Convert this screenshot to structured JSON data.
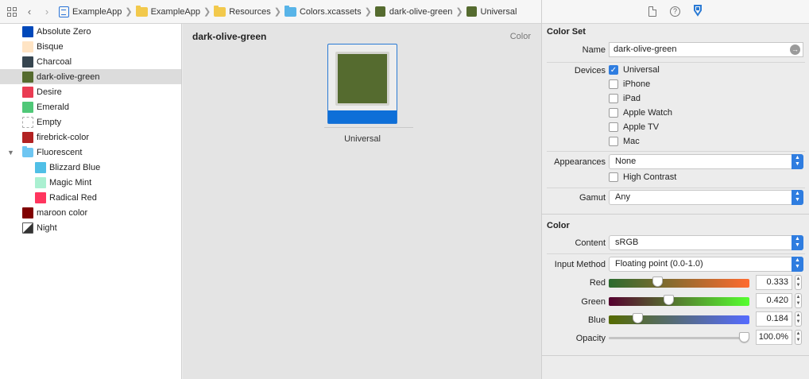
{
  "breadcrumb": {
    "items": [
      {
        "label": "ExampleApp",
        "icon": "project-icon"
      },
      {
        "label": "ExampleApp",
        "icon": "folder-icon"
      },
      {
        "label": "Resources",
        "icon": "folder-icon"
      },
      {
        "label": "Colors.xcassets",
        "icon": "asset-catalog-icon"
      },
      {
        "label": "dark-olive-green",
        "icon": "color-swatch-icon"
      },
      {
        "label": "Universal",
        "icon": "color-swatch-icon"
      }
    ]
  },
  "navigator": {
    "items": [
      {
        "label": "Absolute Zero",
        "color": "#0048ba"
      },
      {
        "label": "Bisque",
        "color": "#ffe4c4"
      },
      {
        "label": "Charcoal",
        "color": "#36454f"
      },
      {
        "label": "dark-olive-green",
        "color": "#556b2f"
      },
      {
        "label": "Desire",
        "color": "#ea3c53"
      },
      {
        "label": "Emerald",
        "color": "#50c878"
      },
      {
        "label": "Empty",
        "color": ""
      },
      {
        "label": "firebrick-color",
        "color": "#b22222"
      },
      {
        "label": "Fluorescent",
        "color": "folder"
      },
      {
        "label": "Blizzard Blue",
        "color": "#50bfe6"
      },
      {
        "label": "Magic Mint",
        "color": "#aaf0d1"
      },
      {
        "label": "Radical Red",
        "color": "#ff355e"
      },
      {
        "label": "maroon color",
        "color": "#800000"
      },
      {
        "label": "Night",
        "color": "night"
      }
    ]
  },
  "editor": {
    "title": "dark-olive-green",
    "type_label": "Color",
    "swatch_color": "#556b2f",
    "well_label": "Universal"
  },
  "inspector": {
    "color_set": {
      "title": "Color Set",
      "name_label": "Name",
      "name_value": "dark-olive-green",
      "devices_label": "Devices",
      "devices": [
        {
          "label": "Universal",
          "checked": true
        },
        {
          "label": "iPhone",
          "checked": false
        },
        {
          "label": "iPad",
          "checked": false
        },
        {
          "label": "Apple Watch",
          "checked": false
        },
        {
          "label": "Apple TV",
          "checked": false
        },
        {
          "label": "Mac",
          "checked": false
        }
      ],
      "appearances_label": "Appearances",
      "appearances_value": "None",
      "high_contrast_label": "High Contrast",
      "gamut_label": "Gamut",
      "gamut_value": "Any"
    },
    "color": {
      "title": "Color",
      "content_label": "Content",
      "content_value": "sRGB",
      "input_method_label": "Input Method",
      "input_method_value": "Floating point (0.0-1.0)",
      "sliders": [
        {
          "label": "Red",
          "value": "0.333",
          "fraction": 0.333
        },
        {
          "label": "Green",
          "value": "0.420",
          "fraction": 0.42
        },
        {
          "label": "Blue",
          "value": "0.184",
          "fraction": 0.184
        },
        {
          "label": "Opacity",
          "value": "100.0%",
          "fraction": 1.0
        }
      ]
    }
  }
}
